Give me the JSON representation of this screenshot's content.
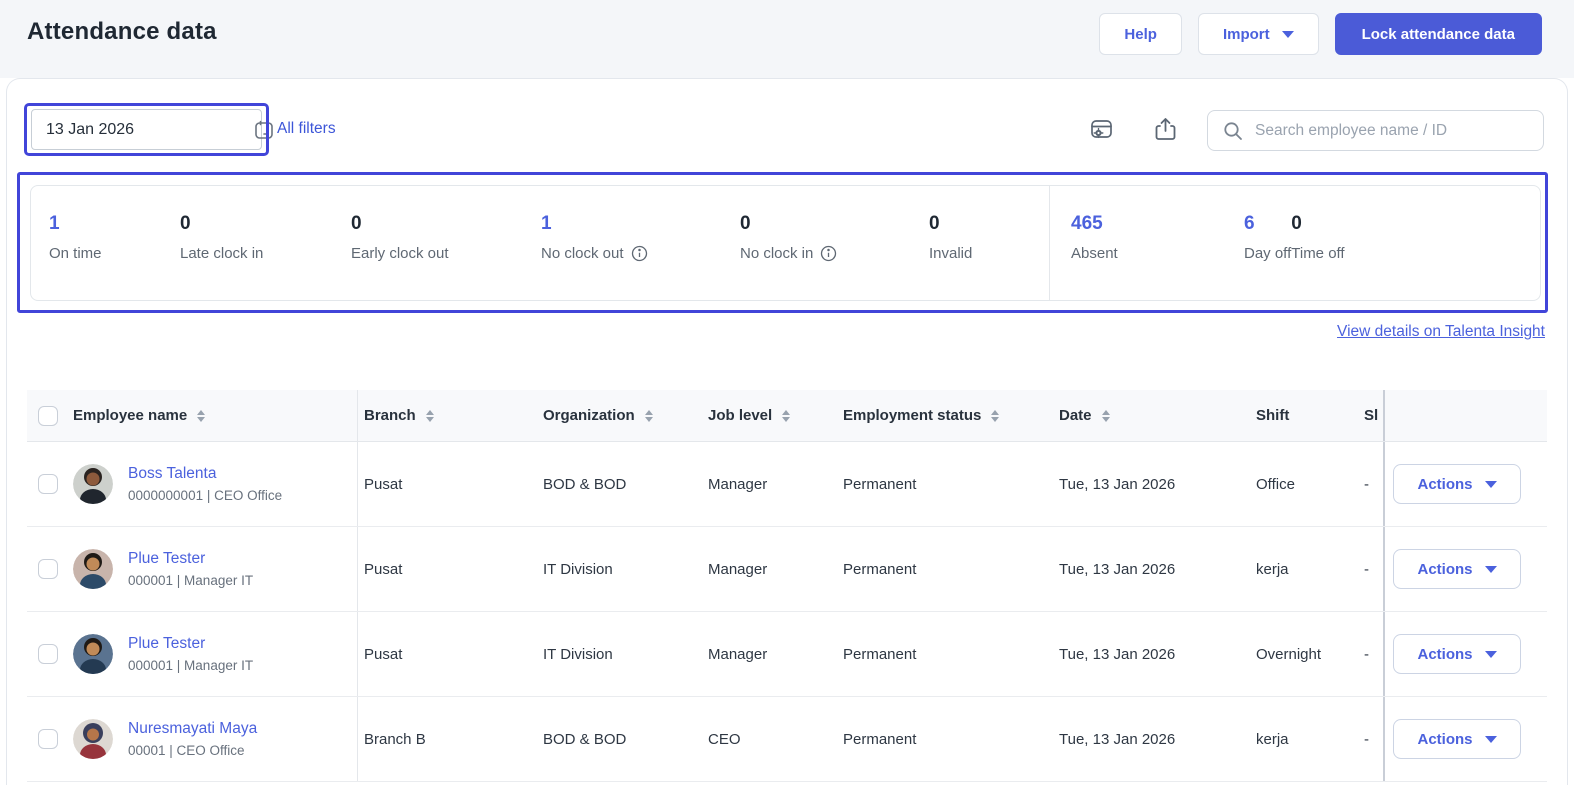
{
  "header": {
    "title": "Attendance data",
    "help_label": "Help",
    "import_label": "Import",
    "lock_label": "Lock attendance data"
  },
  "filters": {
    "date_value": "13 Jan 2026",
    "all_filters_label": "All filters",
    "search_placeholder": "Search employee name / ID"
  },
  "icons": [
    "calendar-icon",
    "attendance-settings-icon",
    "export-icon",
    "search-icon",
    "info-icon",
    "sort-icon",
    "caret-down-icon"
  ],
  "colors": {
    "accent": "#4b61dd",
    "annotation": "#4145d9",
    "primary_button": "#4b5bd7",
    "table_header_bg": "#f8f9fb"
  },
  "stats": {
    "items": [
      {
        "value": "1",
        "label": "On time"
      },
      {
        "value": "0",
        "label": "Late clock in"
      },
      {
        "value": "0",
        "label": "Early clock out"
      },
      {
        "value": "1",
        "label": "No clock out"
      },
      {
        "value": "0",
        "label": "No clock in"
      },
      {
        "value": "0",
        "label": "Invalid"
      },
      {
        "value": "465",
        "label": "Absent"
      },
      {
        "value": "6",
        "label": "Day off"
      },
      {
        "value": "0",
        "label": "Time off"
      }
    ]
  },
  "insight": {
    "label": "View details on Talenta Insight"
  },
  "table": {
    "columns": [
      {
        "label": "Employee name"
      },
      {
        "label": "Branch"
      },
      {
        "label": "Organization"
      },
      {
        "label": "Job level"
      },
      {
        "label": "Employment status"
      },
      {
        "label": "Date"
      },
      {
        "label": "Shift"
      },
      {
        "label": "Sl"
      }
    ],
    "actions_label": "Actions",
    "rows": [
      {
        "name": "Boss Talenta",
        "meta": "0000000001 | CEO Office",
        "branch": "Pusat",
        "organization": "BOD & BOD",
        "job_level": "Manager",
        "employment_status": "Permanent",
        "date": "Tue, 13 Jan 2026",
        "shift": "Office",
        "shift_in": "-",
        "avatar": {
          "bg": "#cdd0cc",
          "hair": "#2a2320",
          "skin": "#8d5a3c",
          "shirt": "#20262e"
        }
      },
      {
        "name": "Plue Tester",
        "meta": "000001 | Manager IT",
        "branch": "Pusat",
        "organization": "IT Division",
        "job_level": "Manager",
        "employment_status": "Permanent",
        "date": "Tue, 13 Jan 2026",
        "shift": "kerja",
        "shift_in": "-",
        "avatar": {
          "bg": "#c8b4ab",
          "hair": "#1f1a16",
          "skin": "#c08a58",
          "shirt": "#2c4a68"
        }
      },
      {
        "name": "Plue Tester",
        "meta": "000001 | Manager IT",
        "branch": "Pusat",
        "organization": "IT Division",
        "job_level": "Manager",
        "employment_status": "Permanent",
        "date": "Tue, 13 Jan 2026",
        "shift": "Overnight",
        "shift_in": "-",
        "avatar": {
          "bg": "#5a7390",
          "hair": "#1f1a16",
          "skin": "#c08a58",
          "shirt": "#243a52"
        }
      },
      {
        "name": "Nuresmayati Maya",
        "meta": "00001 | CEO Office",
        "branch": "Branch B",
        "organization": "BOD & BOD",
        "job_level": "CEO",
        "employment_status": "Permanent",
        "date": "Tue, 13 Jan 2026",
        "shift": "kerja",
        "shift_in": "-",
        "avatar": {
          "bg": "#ddd8d2",
          "hair": "#3a3f5c",
          "skin": "#b5764a",
          "shirt": "#97343c"
        }
      }
    ]
  }
}
